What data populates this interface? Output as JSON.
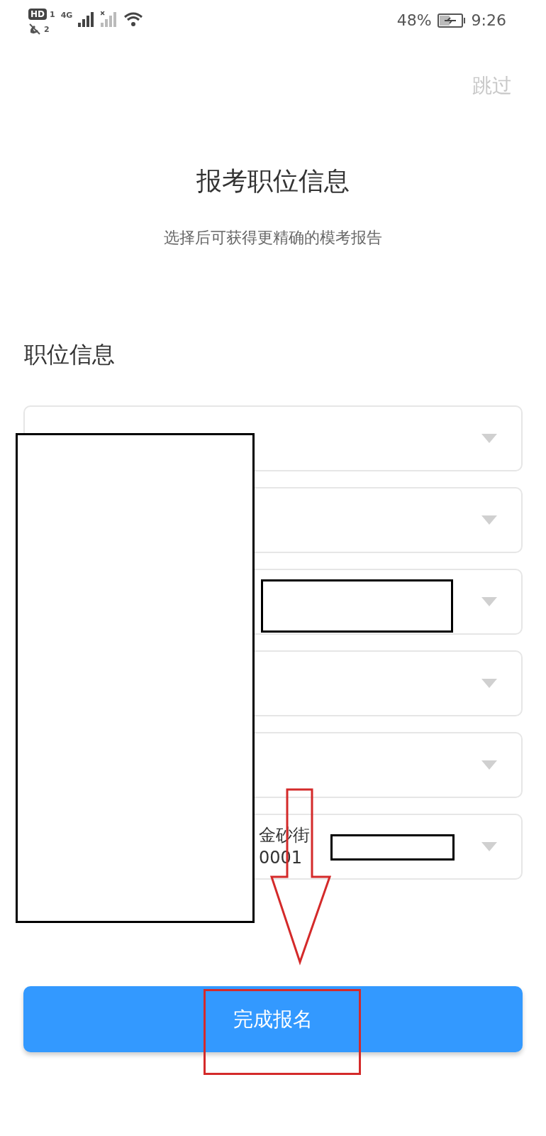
{
  "status_bar": {
    "hd": "HD",
    "sim1": "1",
    "sim2": "2",
    "network": "4G",
    "battery": "48%",
    "time": "9:26"
  },
  "skip": "跳过",
  "title": "报考职位信息",
  "subtitle": "选择后可获得更精确的模考报告",
  "section": "职位信息",
  "fields": [
    {
      "kind": "dropdown"
    },
    {
      "kind": "dropdown"
    },
    {
      "kind": "dropdown"
    },
    {
      "kind": "dropdown"
    },
    {
      "kind": "dropdown"
    },
    {
      "kind": "dropdown",
      "lines": [
        "金砂街",
        "0001"
      ]
    }
  ],
  "submit": "完成报名"
}
